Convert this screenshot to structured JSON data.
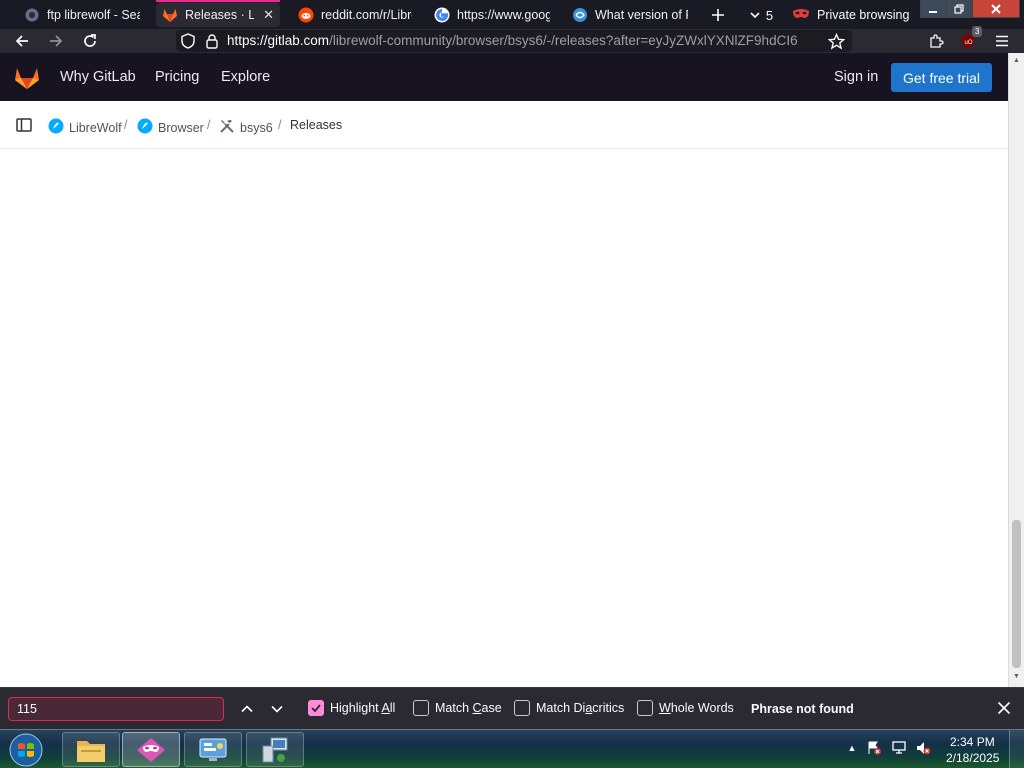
{
  "browser": {
    "tabs": [
      {
        "title": "ftp librewolf - Sear",
        "icon": "search-engine-icon"
      },
      {
        "title": "Releases · Libre",
        "icon": "gitlab-icon",
        "active": true
      },
      {
        "title": "reddit.com/r/Libre",
        "icon": "reddit-icon"
      },
      {
        "title": "https://www.goog",
        "icon": "google-icon"
      },
      {
        "title": "What version of Fi",
        "icon": "website-icon"
      }
    ],
    "tab_overflow_count": "5",
    "private_label": "Private browsing",
    "url_host": "https://gitlab.com",
    "url_path": "/librewolf-community/browser/bsys6/-/releases?after=eyJyZWxlYXNlZF9hdCI6",
    "addon_badge": "3"
  },
  "gitlab": {
    "nav": [
      "Why GitLab",
      "Pricing",
      "Explore"
    ],
    "sign_in": "Sign in",
    "cta": "Get free trial",
    "breadcrumb": [
      "LibreWolf",
      "Browser",
      "bsys6",
      "Releases"
    ],
    "breadcrumb_sep": "/"
  },
  "findbar": {
    "query": "115",
    "options": [
      {
        "pre": "Highlight ",
        "u": "A",
        "post": "ll",
        "checked": true
      },
      {
        "pre": "Match ",
        "u": "C",
        "post": "ase",
        "checked": false
      },
      {
        "pre": "Match Di",
        "u": "a",
        "post": "critics",
        "checked": false
      },
      {
        "pre": "",
        "u": "W",
        "post": "hole Words",
        "checked": false
      }
    ],
    "status": "Phrase not found"
  },
  "taskbar": {
    "time": "2:34 PM",
    "date": "2/18/2025"
  },
  "colors": {
    "gitlab_header": "#171321",
    "cta_blue": "#1f75cb",
    "find_not_found_border": "#e22850",
    "checkbox_checked": "#ff8ad8",
    "active_tab_accent": "#ec2a8f"
  }
}
